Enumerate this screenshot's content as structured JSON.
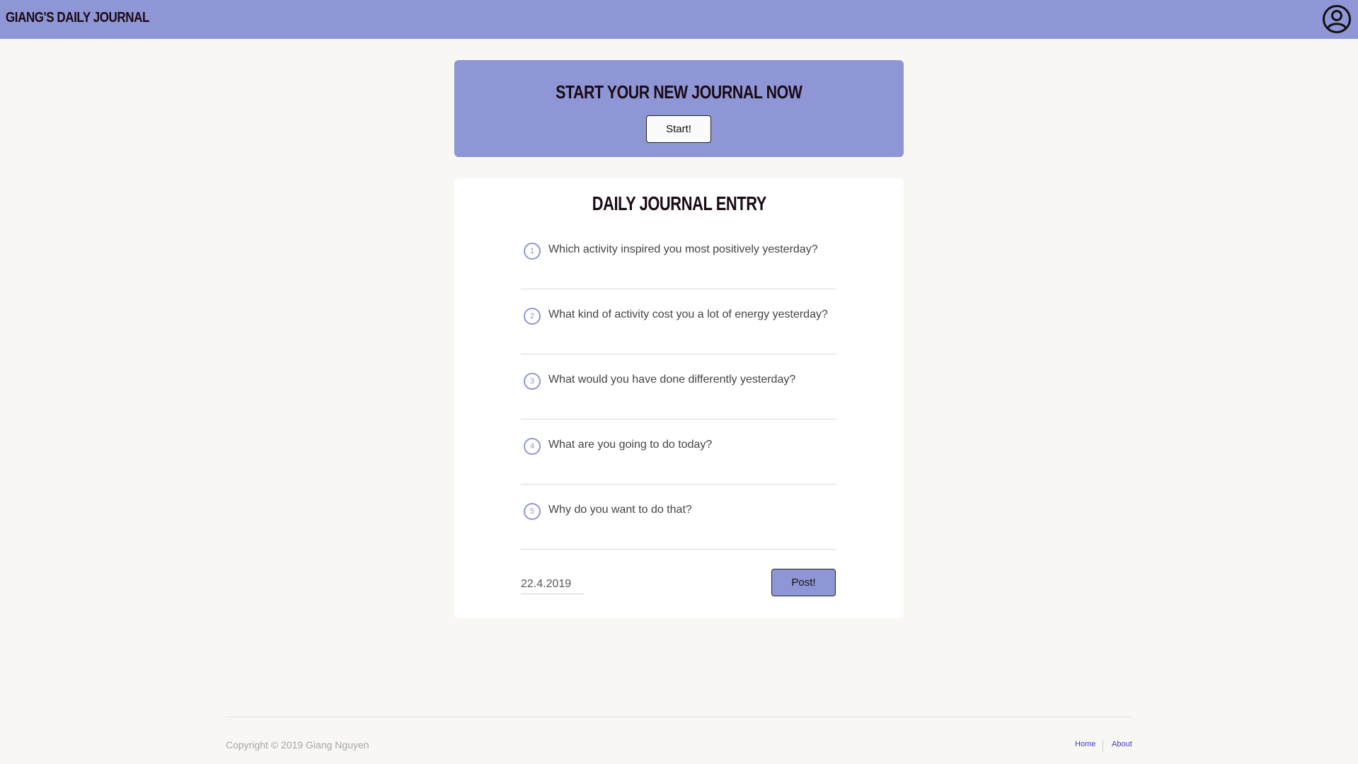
{
  "header": {
    "brand": "GIANG'S DAILY JOURNAL",
    "account_icon": "user-circle-icon",
    "color": "#8f96d5"
  },
  "hero": {
    "title": "START YOUR NEW JOURNAL NOW",
    "start_label": "Start!"
  },
  "journal": {
    "title": "DAILY JOURNAL ENTRY",
    "questions": [
      {
        "number": "1",
        "text": "Which activity inspired you most positively yesterday?"
      },
      {
        "number": "2",
        "text": "What kind of activity cost you a lot of energy yesterday?"
      },
      {
        "number": "3",
        "text": "What would you have done differently yesterday?"
      },
      {
        "number": "4",
        "text": "What are you going to do today?"
      },
      {
        "number": "5",
        "text": "Why do you want to do that?"
      }
    ],
    "date_value": "22.4.2019",
    "post_label": "Post!"
  },
  "footer": {
    "copyright": "Copyright © 2019 Giang Nguyen",
    "links": [
      {
        "label": "Home"
      },
      {
        "label": "About"
      }
    ]
  }
}
